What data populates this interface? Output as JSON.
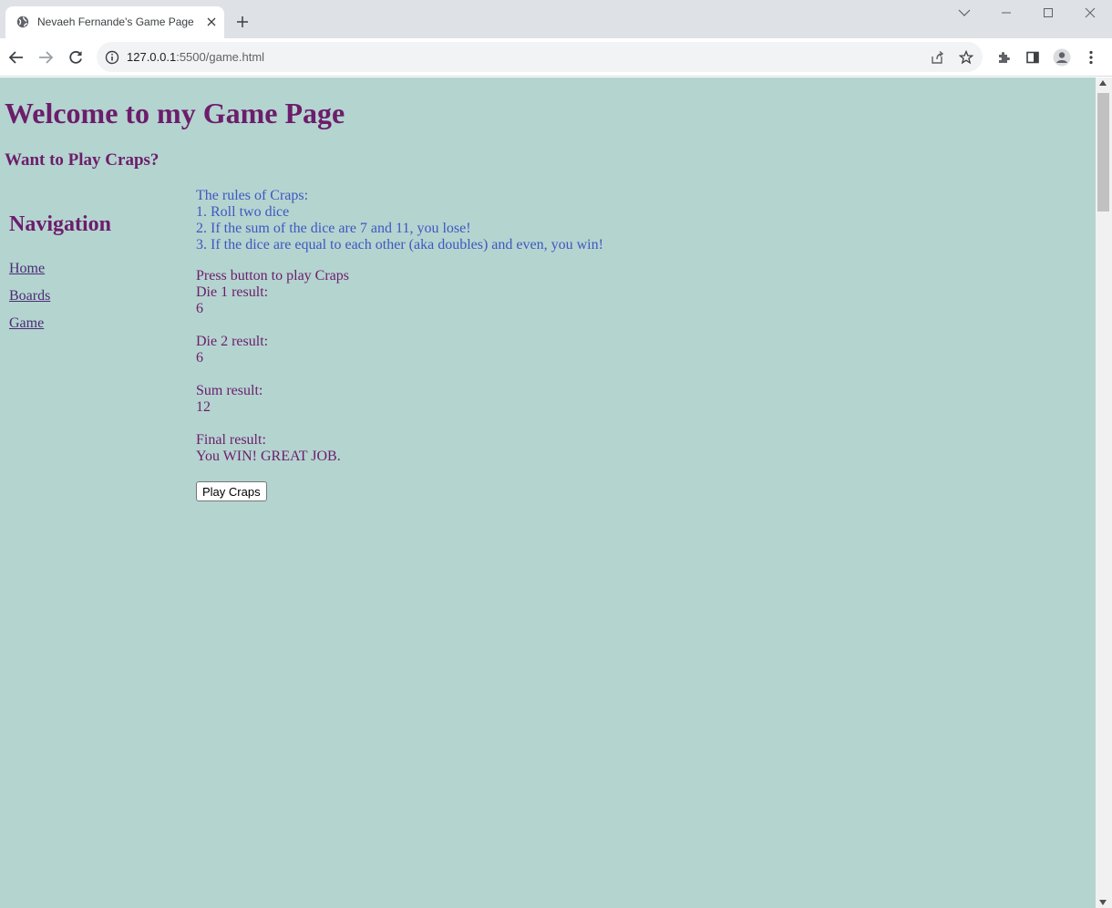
{
  "browser": {
    "tab_title": "Nevaeh Fernande's Game Page",
    "url_host": "127.0.0.1",
    "url_rest": ":5500/game.html"
  },
  "page": {
    "title": "Welcome to my Game Page",
    "subtitle": "Want to Play Craps?",
    "nav": {
      "heading": "Navigation",
      "links": [
        "Home",
        "Boards",
        "Game"
      ]
    },
    "rules": [
      "The rules of Craps:",
      "1. Roll two dice",
      "2. If the sum of the dice are 7 and 11, you lose!",
      "3. If the dice are equal to each other (aka doubles) and even, you win!"
    ],
    "game": {
      "prompt": "Press button to play Craps",
      "die1_label": "Die 1 result:",
      "die1_value": "6",
      "die2_label": "Die 2 result:",
      "die2_value": "6",
      "sum_label": "Sum result:",
      "sum_value": "12",
      "final_label": "Final result:",
      "final_value": "You WIN! GREAT JOB.",
      "button_label": "Play Craps"
    }
  },
  "colors": {
    "page_background": "#b4d4d0",
    "heading": "#6c1d6b",
    "rules_text": "#3f57c0"
  }
}
